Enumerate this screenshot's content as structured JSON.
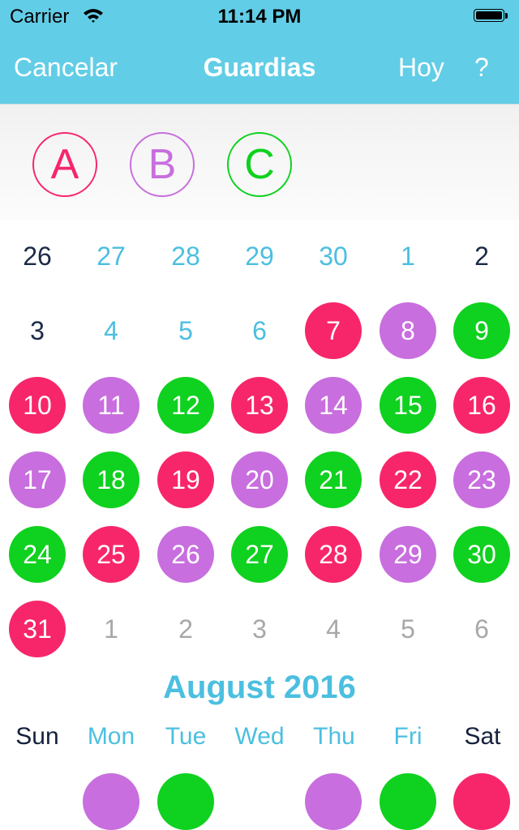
{
  "status": {
    "carrier": "Carrier",
    "time": "11:14 PM"
  },
  "nav": {
    "cancel": "Cancelar",
    "title": "Guardias",
    "today": "Hoy",
    "help": "?"
  },
  "colors": {
    "header": "#62cde6",
    "shift_a": "#f7266a",
    "shift_b": "#c86ede",
    "shift_c": "#0fd11f",
    "accent_text": "#4bbfe0"
  },
  "shifts": [
    {
      "label": "A",
      "color": "#f7266a"
    },
    {
      "label": "B",
      "color": "#c86ede"
    },
    {
      "label": "C",
      "color": "#0fd11f"
    }
  ],
  "calendar": {
    "weeks": [
      [
        {
          "d": "26",
          "t": "prev-weekend"
        },
        {
          "d": "27",
          "t": "prev-weekday"
        },
        {
          "d": "28",
          "t": "prev-weekday"
        },
        {
          "d": "29",
          "t": "prev-weekday"
        },
        {
          "d": "30",
          "t": "prev-weekday"
        },
        {
          "d": "1",
          "t": "prev-weekday"
        },
        {
          "d": "2",
          "t": "prev-weekend"
        }
      ],
      [
        {
          "d": "3",
          "t": "prev-weekend"
        },
        {
          "d": "4",
          "t": "prev-weekday"
        },
        {
          "d": "5",
          "t": "prev-weekday"
        },
        {
          "d": "6",
          "t": "prev-weekday"
        },
        {
          "d": "7",
          "t": "a"
        },
        {
          "d": "8",
          "t": "b"
        },
        {
          "d": "9",
          "t": "c"
        }
      ],
      [
        {
          "d": "10",
          "t": "a"
        },
        {
          "d": "11",
          "t": "b"
        },
        {
          "d": "12",
          "t": "c"
        },
        {
          "d": "13",
          "t": "a"
        },
        {
          "d": "14",
          "t": "b"
        },
        {
          "d": "15",
          "t": "c"
        },
        {
          "d": "16",
          "t": "a"
        }
      ],
      [
        {
          "d": "17",
          "t": "b"
        },
        {
          "d": "18",
          "t": "c"
        },
        {
          "d": "19",
          "t": "a"
        },
        {
          "d": "20",
          "t": "b"
        },
        {
          "d": "21",
          "t": "c"
        },
        {
          "d": "22",
          "t": "a"
        },
        {
          "d": "23",
          "t": "b"
        }
      ],
      [
        {
          "d": "24",
          "t": "c"
        },
        {
          "d": "25",
          "t": "a"
        },
        {
          "d": "26",
          "t": "b"
        },
        {
          "d": "27",
          "t": "c"
        },
        {
          "d": "28",
          "t": "a"
        },
        {
          "d": "29",
          "t": "b"
        },
        {
          "d": "30",
          "t": "c"
        }
      ],
      [
        {
          "d": "31",
          "t": "a"
        },
        {
          "d": "1",
          "t": "next"
        },
        {
          "d": "2",
          "t": "next"
        },
        {
          "d": "3",
          "t": "next"
        },
        {
          "d": "4",
          "t": "next"
        },
        {
          "d": "5",
          "t": "next"
        },
        {
          "d": "6",
          "t": "next"
        }
      ]
    ],
    "next_month": {
      "title": "August 2016",
      "weekdays": [
        "Sun",
        "Mon",
        "Tue",
        "Wed",
        "Thu",
        "Fri",
        "Sat"
      ],
      "partial_row": [
        "",
        "b",
        "c",
        "",
        "b",
        "c",
        "a"
      ]
    }
  }
}
